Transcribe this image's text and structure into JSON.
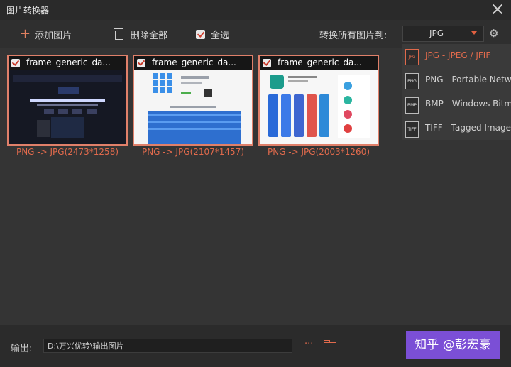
{
  "window": {
    "title": "图片转换器"
  },
  "toolbar": {
    "add_label": "添加图片",
    "delete_all_label": "删除全部",
    "select_all_label": "全选",
    "convert_all_to_label": "转换所有图片到:",
    "format_value": "JPG"
  },
  "images": [
    {
      "name": "frame_generic_da...",
      "conversion": "PNG -> JPG(2473*1258)"
    },
    {
      "name": "frame_generic_da...",
      "conversion": "PNG -> JPG(2107*1457)"
    },
    {
      "name": "frame_generic_da...",
      "conversion": "PNG -> JPG(2003*1260)"
    }
  ],
  "format_menu": [
    {
      "icon": "JPG",
      "label": "JPG - JPEG / JFIF"
    },
    {
      "icon": "PNG",
      "label": "PNG - Portable Networ"
    },
    {
      "icon": "BMP",
      "label": "BMP - Windows Bitmap"
    },
    {
      "icon": "TIFF",
      "label": "TIFF - Tagged Image"
    }
  ],
  "footer": {
    "output_label": "输出:",
    "output_path": "D:\\万兴优转\\输出图片",
    "more_label": "···",
    "convert_button": "知乎 @彭宏豪"
  }
}
